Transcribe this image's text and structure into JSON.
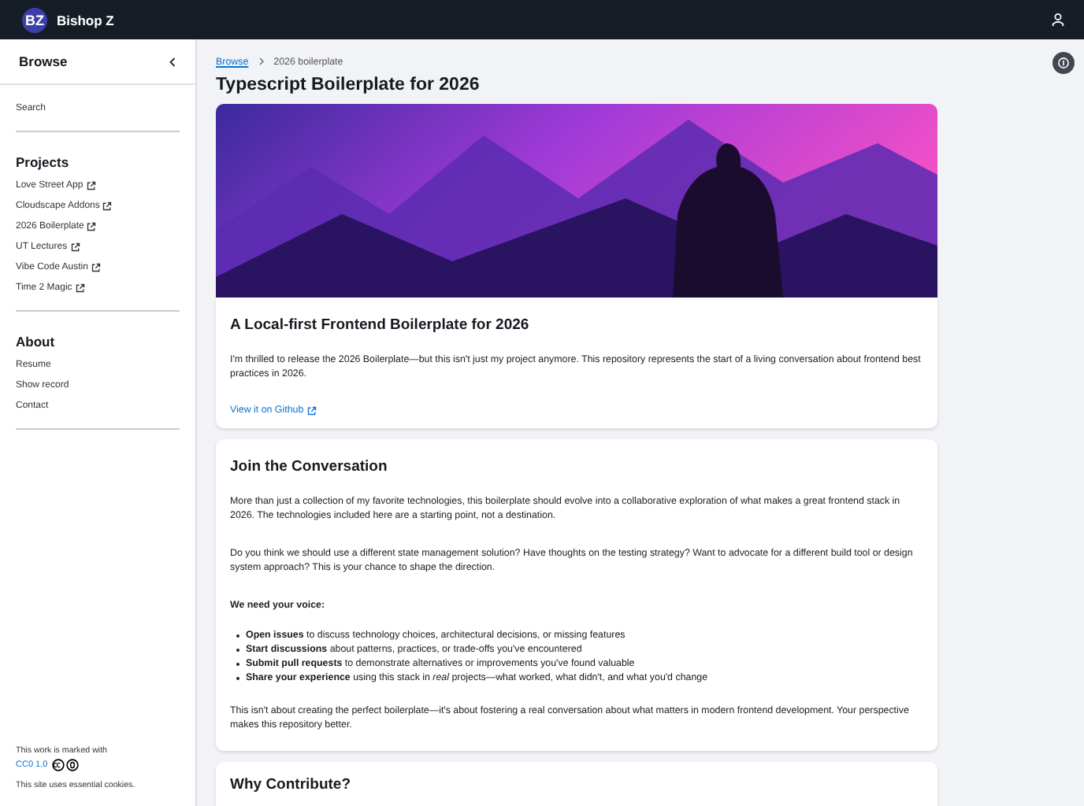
{
  "header": {
    "logo": "BZ",
    "title": "Bishop Z"
  },
  "sidebar": {
    "title": "Browse",
    "search": "Search",
    "sections": [
      {
        "title": "Projects",
        "items": [
          {
            "label": "Love Street App",
            "external": true
          },
          {
            "label": "Cloudscape Addons",
            "external": true
          },
          {
            "label": "2026 Boilerplate",
            "external": true
          },
          {
            "label": "UT Lectures",
            "external": true
          },
          {
            "label": "Vibe Code Austin",
            "external": true
          },
          {
            "label": "Time 2 Magic",
            "external": true
          }
        ]
      },
      {
        "title": "About",
        "items": [
          {
            "label": "Resume",
            "external": false
          },
          {
            "label": "Show record",
            "external": false
          },
          {
            "label": "Contact",
            "external": false
          }
        ]
      }
    ],
    "footer": {
      "notice": "This work is marked with",
      "license": "CC0 1.0",
      "cookies": "This site uses essential cookies."
    }
  },
  "breadcrumbs": [
    {
      "label": "Browse",
      "link": true
    },
    {
      "label": "2026 boilerplate",
      "link": false
    }
  ],
  "page_title": "Typescript Boilerplate for 2026",
  "cards": [
    {
      "title": "A Local-first Frontend Boilerplate for 2026",
      "blocks": [
        {
          "kind": "paragraph",
          "text": "I'm thrilled to release the 2026 Boilerplate—but this isn't just my project anymore. This repository represents the start of a living conversation about frontend best practices in 2026."
        },
        {
          "kind": "link",
          "text": "View it on Github"
        }
      ]
    },
    {
      "title": "Join the Conversation",
      "blocks": [
        {
          "kind": "paragraph",
          "text": "More than just a collection of my favorite technologies, this boilerplate should evolve into a collaborative exploration of what makes a great frontend stack in 2026. The technologies included here are a starting point, not a destination."
        },
        {
          "kind": "paragraph",
          "text": "Do you think we should use a different state management solution? Have thoughts on the testing strategy? Want to advocate for a different build tool or design system approach? This is your chance to shape the direction."
        },
        {
          "kind": "heading",
          "text": "We need your voice:"
        },
        {
          "kind": "list",
          "items": [
            "**Open issues** to discuss technology choices, architectural decisions, or missing features",
            "**Start discussions** about patterns, practices, or trade-offs you've encountered",
            "**Submit pull requests** to demonstrate alternatives or improvements you've found valuable",
            "**Share your experience** using this stack in *real* projects—what worked, what didn't, and what you'd change"
          ]
        },
        {
          "kind": "paragraph",
          "text": "This isn't about creating the perfect boilerplate—it's about fostering a real conversation about what matters in modern frontend development. Your perspective makes this repository better."
        }
      ]
    },
    {
      "title": "Why Contribute?"
    }
  ]
}
